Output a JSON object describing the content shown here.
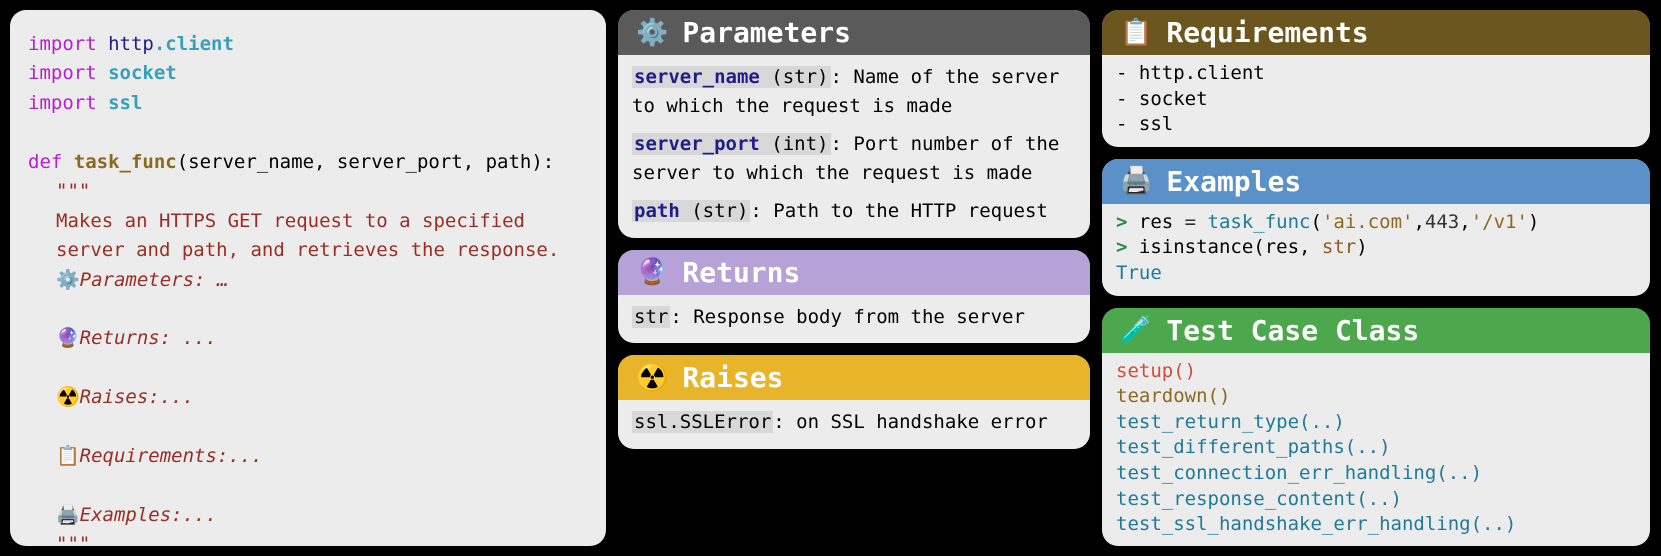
{
  "code": {
    "kw_import": "import",
    "http_mod": "http",
    "http_client": ".client",
    "socket": "socket",
    "ssl": "ssl",
    "kw_def": "def",
    "fn_name": "task_func",
    "sig_rest": "(server_name, server_port, path):",
    "triple": "\"\"\"",
    "desc1": "Makes an HTTPS GET request to a specified",
    "desc2": "server and path, and retrieves the response.",
    "params_label": "Parameters: …",
    "returns_label": "Returns: ...",
    "raises_label": "Raises:...",
    "req_label": "Requirements:...",
    "ex_label": "Examples:..."
  },
  "parameters": {
    "title": "Parameters",
    "icon": "⚙️",
    "p1_name": "server_name",
    "p1_type": "(str)",
    "p1_desc": ": Name of the server to which the request is made",
    "p2_name": "server_port",
    "p2_type": "(int)",
    "p2_desc": ": Port number of the server to which the request is made",
    "p3_name": "path",
    "p3_type": "(str)",
    "p3_desc": ": Path to the HTTP request"
  },
  "returns": {
    "title": "Returns",
    "icon": "🔮",
    "type": "str",
    "desc": ": Response body from the server"
  },
  "raises": {
    "title": "Raises",
    "icon": "☢️",
    "type": "ssl.SSLError",
    "desc": ": on SSL handshake error"
  },
  "requirements": {
    "title": "Requirements",
    "icon": "📋",
    "r1": "-  http.client",
    "r2": "-  socket",
    "r3": "-  ssl"
  },
  "examples": {
    "title": "Examples",
    "icon": "🖨️",
    "prompt": ">",
    "l1_var": " res",
    "l1_eq": " = ",
    "l1_fn": "task_func",
    "l1_open": "(",
    "l1_s1": "'ai.com'",
    "l1_c1": ",",
    "l1_num": "443",
    "l1_c2": ",",
    "l1_s2": "'/v1'",
    "l1_close": ")",
    "l2_rest": " isinstance(res, ",
    "l2_type": "str",
    "l2_close": ")",
    "l3": "True"
  },
  "tests": {
    "title": "Test Case Class",
    "icon": "🧪",
    "m1": "setup()",
    "m2": "teardown()",
    "m3": "test_return_type(..)",
    "m4": "test_different_paths(..)",
    "m5": "test_connection_err_handling(..)",
    "m6": "test_response_content(..)",
    "m7": "test_ssl_handshake_err_handling(..)"
  }
}
